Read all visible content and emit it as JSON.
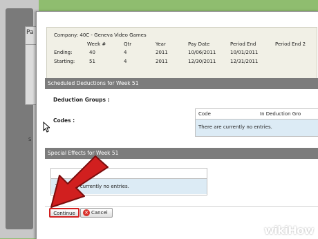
{
  "background": {
    "fragment_text_1": "Pa",
    "fragment_text_2": "S"
  },
  "company_info": {
    "company_line": "Company: 40C - Geneva Video Games",
    "columns": [
      "Week #",
      "Qtr",
      "Year",
      "Pay Date",
      "Period End",
      "Period End 2"
    ],
    "rows": [
      {
        "label": "Ending:",
        "cells": [
          "40",
          "4",
          "2011",
          "10/06/2011",
          "10/01/2011"
        ]
      },
      {
        "label": "Starting:",
        "cells": [
          "51",
          "4",
          "2011",
          "12/30/2011",
          "12/31/2011"
        ]
      }
    ]
  },
  "scheduled_deductions": {
    "header": "Scheduled Deductions for Week 51",
    "groups_label": "Deduction Groups :",
    "codes_label": "Codes :",
    "table_columns": [
      "Code",
      "In Deduction Gro"
    ],
    "empty_text": "There are currently no entries."
  },
  "special_effects": {
    "header": "Special Effects for Week 51",
    "empty_text": "There are currently no entries."
  },
  "actions": {
    "continue_label": "Continue",
    "cancel_label": "Cancel",
    "cancel_icon_glyph": "✕"
  },
  "watermark": {
    "wiki": "wiki",
    "how": "How"
  },
  "colors": {
    "background": "#8fbd6f",
    "section_bar": "#7c7c7c",
    "info_box": "#f1f0e6",
    "empty_row": "#dcebf5",
    "highlight": "#d11f1f"
  }
}
